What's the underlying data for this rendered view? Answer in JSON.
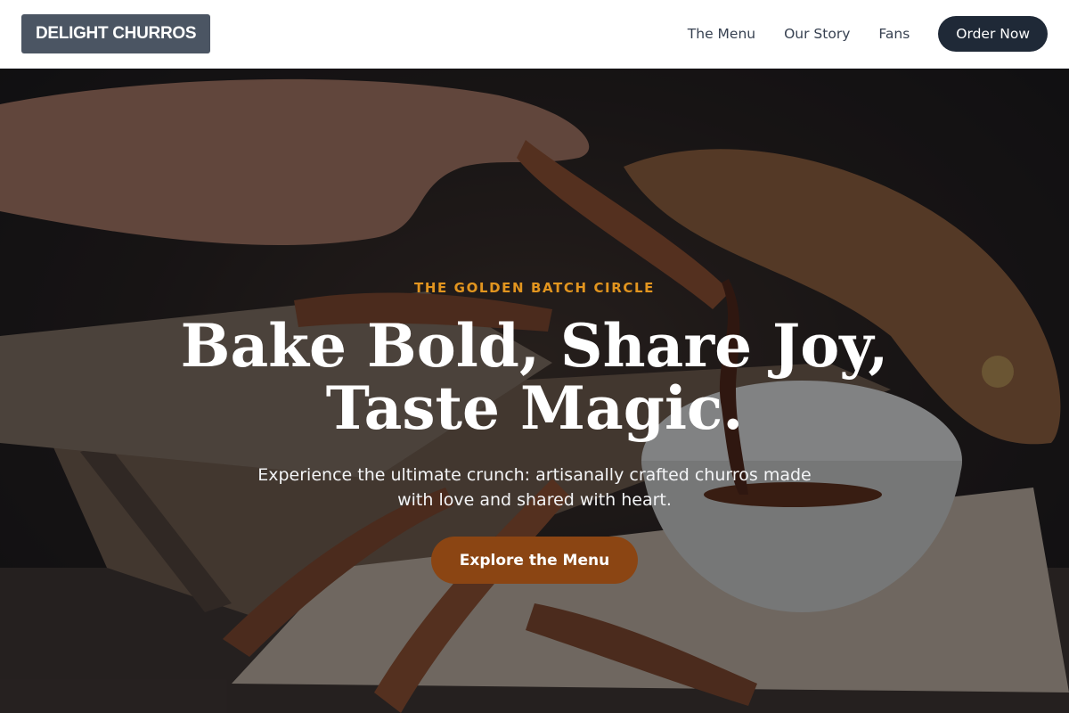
{
  "header": {
    "logo": "DELIGHT CHURROS",
    "nav": [
      "The Menu",
      "Our Story",
      "Fans"
    ],
    "order_button": "Order Now"
  },
  "hero": {
    "eyebrow": "THE GOLDEN BATCH CIRCLE",
    "headline_line1": "Bake Bold, Share Joy,",
    "headline_line2": "Taste Magic.",
    "subtext": "Experience the ultimate crunch: artisanally crafted churros made with love and shared with heart.",
    "cta": "Explore the Menu",
    "background_image": "churros-with-chocolate-dip-photo"
  },
  "colors": {
    "eyebrow": "#e2951f",
    "cta": "#8b4513",
    "order_button": "#1f2937",
    "logo_bg": "#4b5563"
  }
}
